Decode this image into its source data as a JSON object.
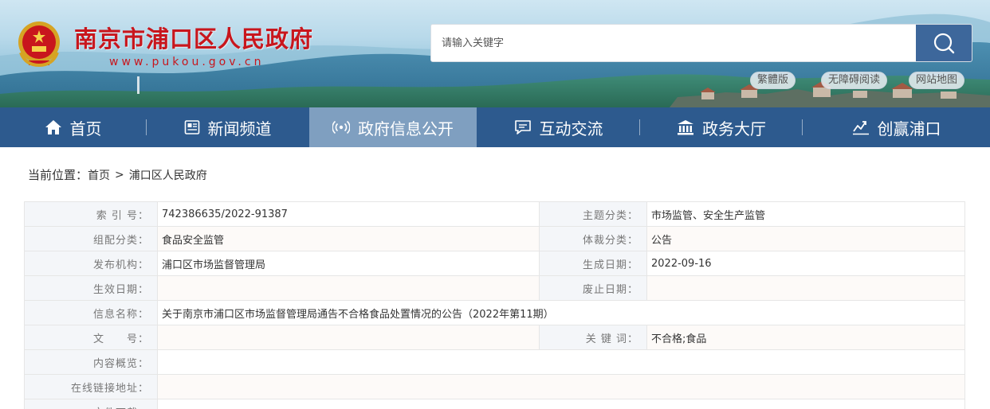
{
  "header": {
    "site_title": "南京市浦口区人民政府",
    "site_url": "www.pukou.gov.cn",
    "search": {
      "placeholder": "请输入关键字"
    },
    "links": [
      "繁體版",
      "无障碍阅读",
      "网站地图"
    ]
  },
  "nav": {
    "items": [
      {
        "label": "首页",
        "icon": "home-icon"
      },
      {
        "label": "新闻频道",
        "icon": "news-icon"
      },
      {
        "label": "政府信息公开",
        "icon": "broadcast-icon",
        "active": true
      },
      {
        "label": "互动交流",
        "icon": "chat-icon"
      },
      {
        "label": "政务大厅",
        "icon": "hall-icon"
      },
      {
        "label": "创赢浦口",
        "icon": "chart-icon"
      }
    ]
  },
  "breadcrumb": {
    "label": "当前位置：",
    "items": [
      "首页",
      "浦口区人民政府"
    ],
    "separator": ">"
  },
  "info": {
    "index_label": "索 引 号：",
    "index_value": "742386635/2022-91387",
    "topic_label": "主题分类：",
    "topic_value": "市场监管、安全生产监管",
    "org_cat_label": "组配分类：",
    "org_cat_value": "食品安全监管",
    "genre_label": "体裁分类：",
    "genre_value": "公告",
    "publisher_label": "发布机构：",
    "publisher_value": "浦口区市场监督管理局",
    "created_label": "生成日期：",
    "created_value": "2022-09-16",
    "effective_label": "生效日期：",
    "effective_value": "",
    "expired_label": "废止日期：",
    "expired_value": "",
    "name_label": "信息名称：",
    "name_value": "关于南京市浦口区市场监督管理局通告不合格食品处置情况的公告（2022年第11期）",
    "doc_no_label": "文　　号：",
    "doc_no_value": "",
    "keywords_label": "关 键 词：",
    "keywords_value": "不合格;食品",
    "summary_label": "内容概览：",
    "summary_value": "",
    "link_label": "在线链接地址：",
    "link_value": "",
    "download_label": "文件下载：",
    "download_value": ""
  },
  "colors": {
    "brand_red": "#c8161d",
    "nav_blue": "#2d5a8e",
    "nav_active": "#7f9fc0",
    "search_btn": "#3d679b"
  }
}
